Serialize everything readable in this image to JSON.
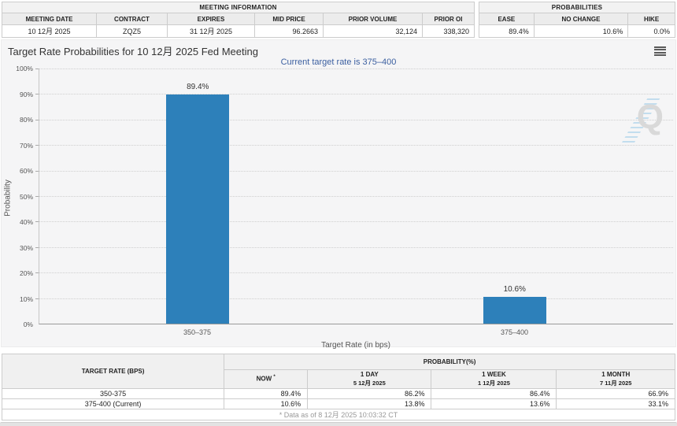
{
  "meeting_info": {
    "title": "MEETING INFORMATION",
    "columns": [
      "MEETING DATE",
      "CONTRACT",
      "EXPIRES",
      "MID PRICE",
      "PRIOR VOLUME",
      "PRIOR OI"
    ],
    "values": [
      "10 12月 2025",
      "ZQZ5",
      "31 12月 2025",
      "96.2663",
      "32,124",
      "338,320"
    ]
  },
  "probabilities_summary": {
    "title": "PROBABILITIES",
    "columns": [
      "EASE",
      "NO CHANGE",
      "HIKE"
    ],
    "values": [
      "89.4%",
      "10.6%",
      "0.0%"
    ]
  },
  "chart_data": {
    "type": "bar",
    "title": "Target Rate Probabilities for 10 12月 2025 Fed Meeting",
    "subtitle": "Current target rate is 375–400",
    "categories": [
      "350–375",
      "375–400"
    ],
    "values": [
      89.4,
      10.6
    ],
    "value_labels": [
      "89.4%",
      "10.6%"
    ],
    "xlabel": "Target Rate (in bps)",
    "ylabel": "Probability",
    "ylim": [
      0,
      100
    ],
    "ytick_step": 10,
    "ytick_suffix": "%",
    "grid": "dotted horizontal gridlines",
    "legend": "none",
    "bar_color": "#2d80ba",
    "watermark_letter": "Q"
  },
  "history_table": {
    "rate_header": "TARGET RATE (BPS)",
    "group_header": "PROBABILITY(%)",
    "now_label": "NOW",
    "now_sup": "*",
    "col_day_label": "1 DAY",
    "col_day_date": "5 12月 2025",
    "col_week_label": "1 WEEK",
    "col_week_date": "1 12月 2025",
    "col_month_label": "1 MONTH",
    "col_month_date": "7 11月 2025",
    "rows": [
      {
        "rate": "350-375",
        "now": "89.4%",
        "day": "86.2%",
        "week": "86.4%",
        "month": "66.9%"
      },
      {
        "rate": "375-400 (Current)",
        "now": "10.6%",
        "day": "13.8%",
        "week": "13.6%",
        "month": "33.1%"
      }
    ],
    "footnote": "* Data as of 8 12月 2025 10:03:32 CT"
  },
  "colors": {
    "bar": "#2d80ba",
    "subtitle_blue": "#3b5fa0",
    "now_highlight": "#fafad2",
    "panel_bg": "#f5f5f6",
    "header_bg": "#ececec"
  }
}
